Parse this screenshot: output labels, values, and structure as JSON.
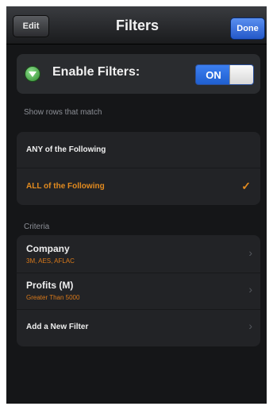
{
  "navbar": {
    "edit_label": "Edit",
    "title": "Filters",
    "done_label": "Done"
  },
  "enable": {
    "label": "Enable Filters:",
    "toggle_label": "ON",
    "icon": "filter-funnel-icon"
  },
  "match": {
    "header": "Show rows that match",
    "options": [
      {
        "label": "ANY of the Following",
        "selected": false
      },
      {
        "label": "ALL of the Following",
        "selected": true
      }
    ],
    "check": "✓"
  },
  "criteria": {
    "header": "Criteria",
    "items": [
      {
        "title": "Company",
        "subtitle": "3M, AES, AFLAC"
      },
      {
        "title": "Profits (M)",
        "subtitle": "Greater Than 5000"
      }
    ],
    "add_label": "Add a New Filter"
  },
  "colors": {
    "accent": "#e38b1f",
    "toggle_blue": "#2f6fe0",
    "background": "#151618"
  }
}
